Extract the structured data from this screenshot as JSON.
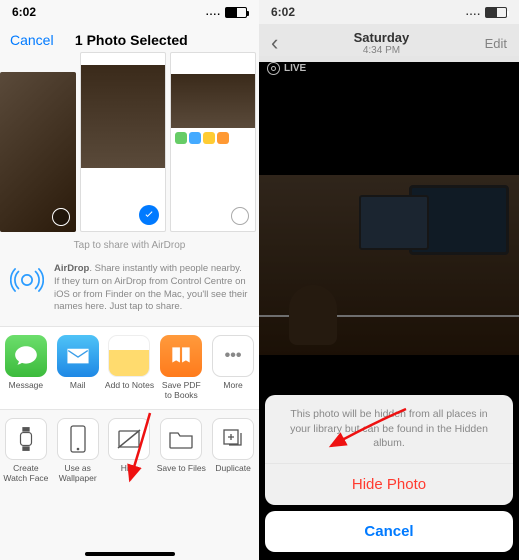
{
  "left": {
    "status": {
      "time": "6:02"
    },
    "header": {
      "cancel": "Cancel",
      "title": "1 Photo Selected"
    },
    "airdrop_hint": "Tap to share with AirDrop",
    "airdrop": {
      "bold": "AirDrop",
      "text": ". Share instantly with people nearby. If they turn on AirDrop from Control Centre on iOS or from Finder on the Mac, you'll see their names here. Just tap to share."
    },
    "apps": {
      "message": "Message",
      "mail": "Mail",
      "notes": "Add to Notes",
      "books_l1": "Save PDF",
      "books_l2": "to Books",
      "more": "More"
    },
    "actions": {
      "watchface_l1": "Create",
      "watchface_l2": "Watch Face",
      "wallpaper_l1": "Use as",
      "wallpaper_l2": "Wallpaper",
      "hide": "Hide",
      "files": "Save to Files",
      "duplicate": "Duplicate"
    }
  },
  "right": {
    "status": {
      "time": "6:02"
    },
    "nav": {
      "title": "Saturday",
      "subtitle": "4:34 PM",
      "edit": "Edit"
    },
    "live_label": "LIVE",
    "sheet": {
      "message": "This photo will be hidden from all places in your library but can be found in the Hidden album.",
      "hide": "Hide Photo",
      "cancel": "Cancel"
    }
  }
}
